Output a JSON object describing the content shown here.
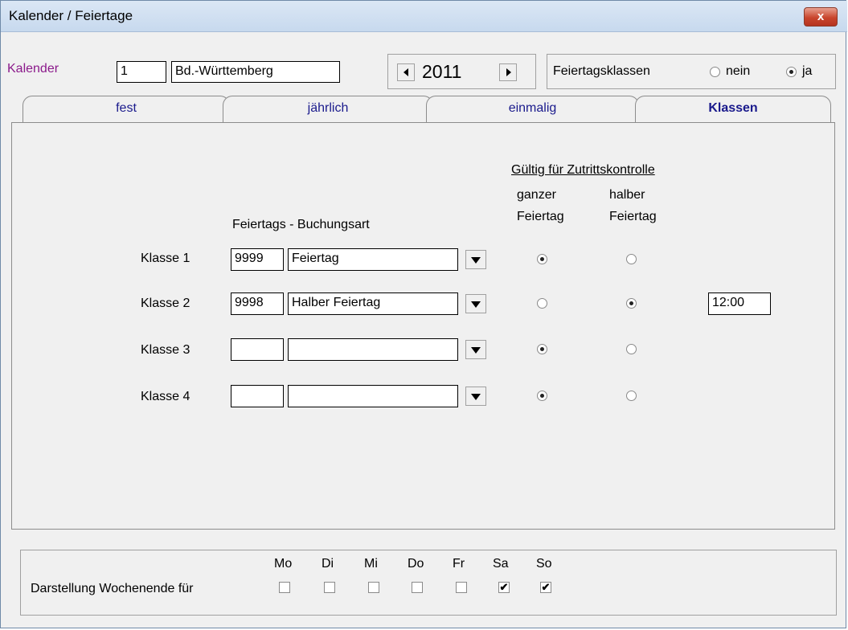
{
  "window": {
    "title": "Kalender / Feiertage",
    "close_label": "x"
  },
  "header": {
    "kalender_label": "Kalender",
    "kalender_nr": "1",
    "kalender_name": "Bd.-Württemberg",
    "year": "2011",
    "feiertagsklassen_label": "Feiertagsklassen",
    "option_nein": "nein",
    "option_ja": "ja",
    "selected_option": "ja"
  },
  "tabs": [
    {
      "label": "fest"
    },
    {
      "label": "jährlich"
    },
    {
      "label": "einmalig"
    },
    {
      "label": "Klassen",
      "active": true
    }
  ],
  "klassen": {
    "gueltig_header": "Gültig für Zutrittskontrolle",
    "col_ganzer_1": "ganzer",
    "col_ganzer_2": "Feiertag",
    "col_halber_1": "halber",
    "col_halber_2": "Feiertag",
    "buchungsart_header": "Feiertags - Buchungsart",
    "rows": [
      {
        "label": "Klasse 1",
        "code": "9999",
        "name": "Feiertag",
        "ganzer": true,
        "halber": false,
        "time": ""
      },
      {
        "label": "Klasse 2",
        "code": "9998",
        "name": "Halber Feiertag",
        "ganzer": false,
        "halber": true,
        "time": "12:00"
      },
      {
        "label": "Klasse 3",
        "code": "",
        "name": "",
        "ganzer": true,
        "halber": false,
        "time": ""
      },
      {
        "label": "Klasse 4",
        "code": "",
        "name": "",
        "ganzer": true,
        "halber": false,
        "time": ""
      }
    ]
  },
  "weekend": {
    "label": "Darstellung Wochenende für",
    "days": [
      {
        "label": "Mo",
        "checked": false
      },
      {
        "label": "Di",
        "checked": false
      },
      {
        "label": "Mi",
        "checked": false
      },
      {
        "label": "Do",
        "checked": false
      },
      {
        "label": "Fr",
        "checked": false
      },
      {
        "label": "Sa",
        "checked": true
      },
      {
        "label": "So",
        "checked": true
      }
    ]
  },
  "colors": {
    "tab_text": "#1a1a8c",
    "kalender_label": "#8b1a8b",
    "titlebar": "#c7d9ee",
    "close_button": "#c9452d"
  }
}
